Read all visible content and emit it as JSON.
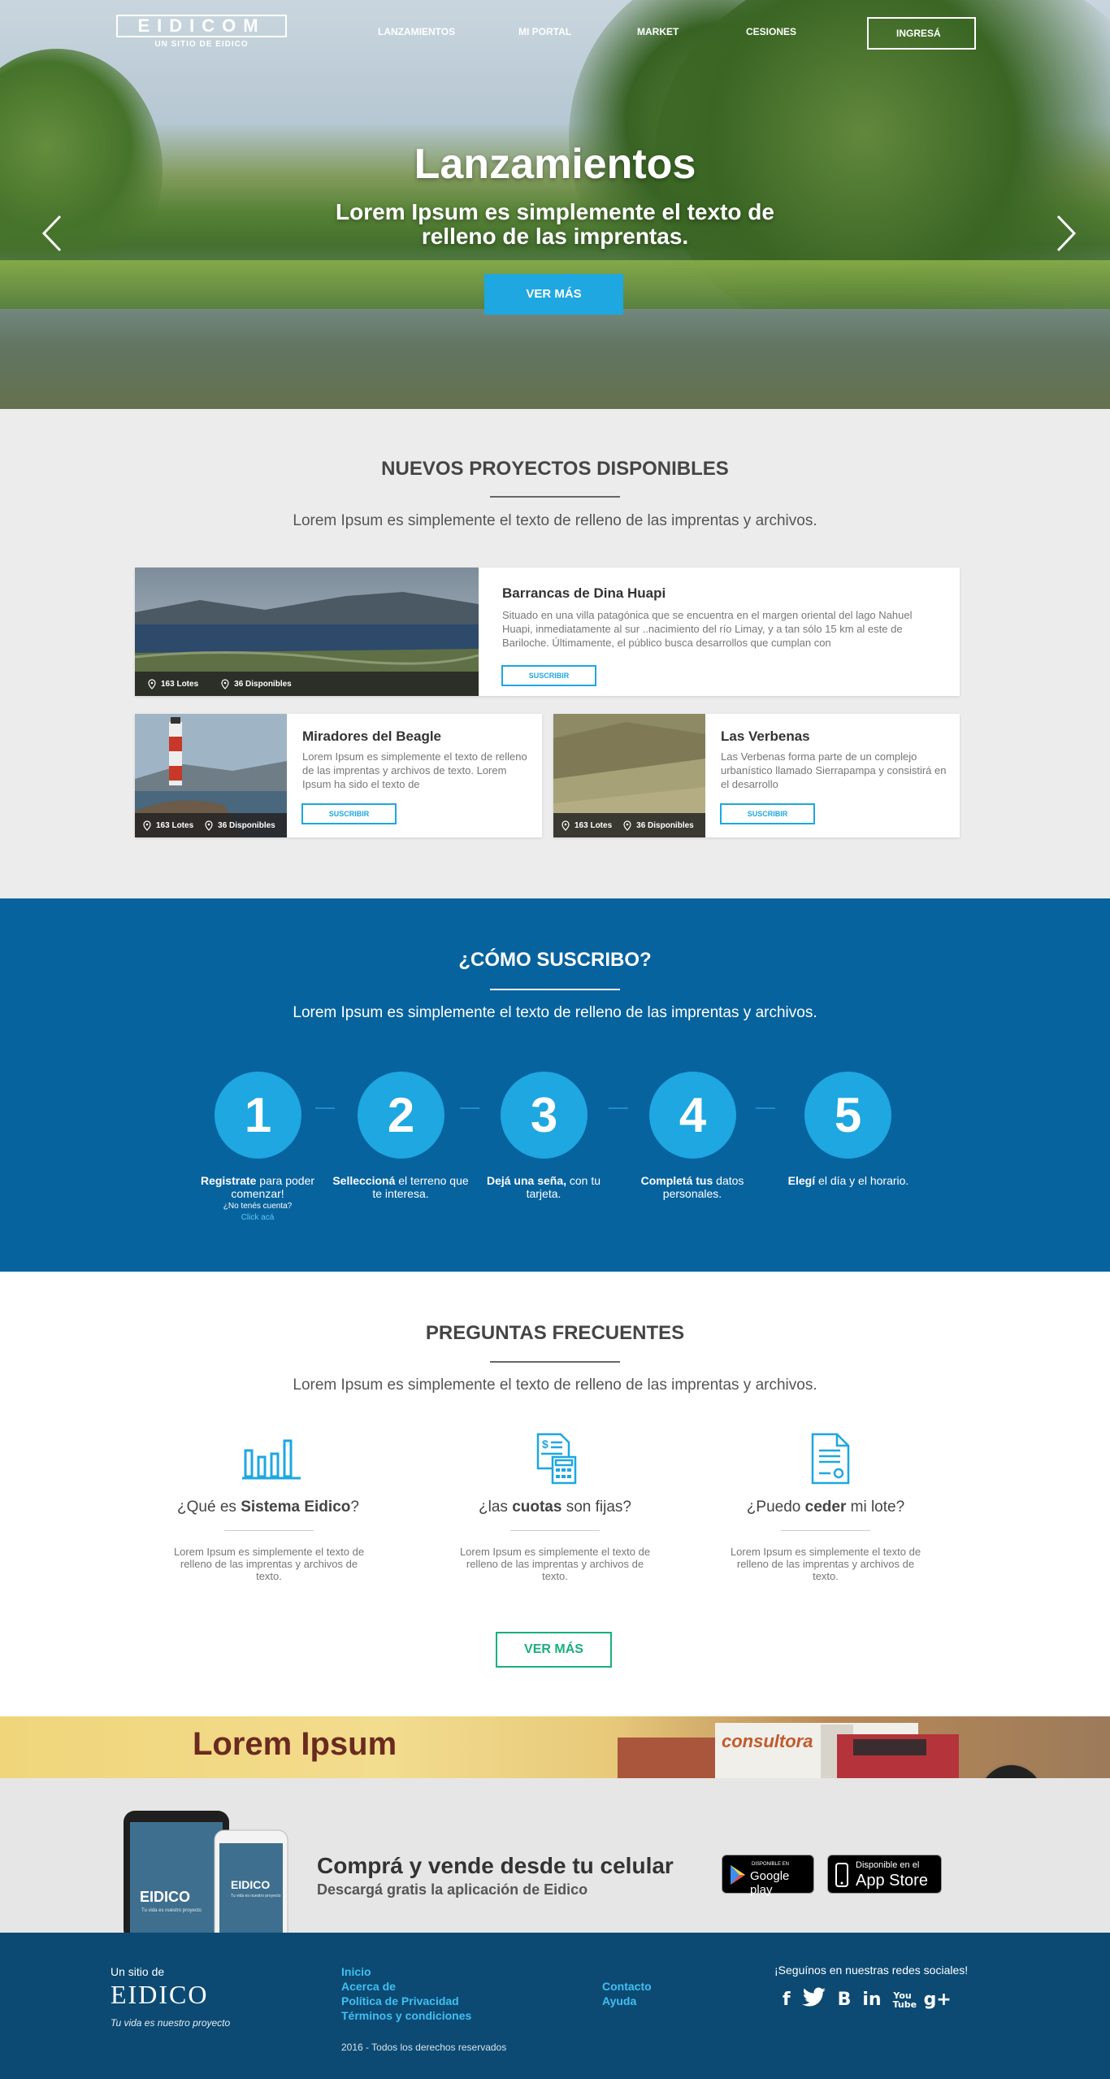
{
  "header": {
    "logo_text": "EIDICOM",
    "logo_sub": "UN SITIO DE EIDICO",
    "nav": [
      "LANZAMIENTOS",
      "MI PORTAL",
      "MARKET",
      "CESIONES"
    ],
    "login_label": "INGRESÁ"
  },
  "hero": {
    "title": "Lanzamientos",
    "subtitle": "Lorem Ipsum es simplemente el texto de relleno de las imprentas.",
    "button": "VER MÁS"
  },
  "proyectos": {
    "title": "NUEVOS PROYECTOS DISPONIBLES",
    "description": "Lorem Ipsum es simplemente el texto de relleno de las imprentas y archivos.",
    "cards": [
      {
        "name": "Barrancas de Dina Huapi",
        "text": "Situado en una villa patagónica que se encuentra en el margen oriental del lago Nahuel Huapi, inmediatamente al sur ..nacimiento del río Limay, y a tan sólo 15 km al este de Bariloche. Últimamente, el público busca desarrollos que cumplan con",
        "lotes": "163 Lotes",
        "disponibles": "36 Disponibles",
        "button": "SUSCRIBIR"
      },
      {
        "name": "Miradores del Beagle",
        "text": "Lorem Ipsum es simplemente el texto de relleno de las imprentas y archivos de texto. Lorem Ipsum ha sido el texto de",
        "lotes": "163 Lotes",
        "disponibles": "36 Disponibles",
        "button": "SUSCRIBIR"
      },
      {
        "name": "Las Verbenas",
        "text": "Las Verbenas forma parte de un complejo urbanístico llamado Sierrapampa y consistirá en el desarrollo",
        "lotes": "163 Lotes",
        "disponibles": "36 Disponibles",
        "button": "SUSCRIBIR"
      }
    ]
  },
  "suscribo": {
    "title": "¿CÓMO SUSCRIBO?",
    "description": "Lorem Ipsum es simplemente el texto de relleno de las imprentas y archivos.",
    "steps": [
      {
        "number": "1",
        "bold": "Registrate",
        "rest": " para poder comenzar!",
        "small": "¿No tenés cuenta?",
        "link": "Click acá"
      },
      {
        "number": "2",
        "bold": "Selleccioná",
        "rest": " el terreno que te interesa."
      },
      {
        "number": "3",
        "bold": "Dejá una seña,",
        "rest": " con tu tarjeta."
      },
      {
        "number": "4",
        "bold": "Completá tus",
        "rest": " datos personales."
      },
      {
        "number": "5",
        "bold": "Elegí",
        "rest": " el día y el horario."
      }
    ]
  },
  "preguntas": {
    "title": "PREGUNTAS FRECUENTES",
    "description": "Lorem Ipsum es simplemente el texto de relleno de las imprentas y archivos.",
    "items": [
      {
        "pre": "¿Qué es ",
        "bold": "Sistema Eidico",
        "post": "?",
        "answer": "Lorem Ipsum es simplemente el texto de relleno de las imprentas y archivos de texto.",
        "icon": "chart-icon"
      },
      {
        "pre": "¿las ",
        "bold": "cuotas",
        "post": " son fijas?",
        "answer": "Lorem Ipsum es simplemente el texto de relleno de las imprentas y archivos de texto.",
        "icon": "calculator-document-icon"
      },
      {
        "pre": "¿Puedo ",
        "bold": "ceder",
        "post": " mi lote?",
        "answer": "Lorem Ipsum es simplemente el texto de relleno de las imprentas y archivos de texto.",
        "icon": "contract-document-icon"
      }
    ],
    "button": "VER MÁS"
  },
  "banner": {
    "title": "Lorem Ipsum",
    "truck_text": "consultora"
  },
  "app": {
    "title": "Comprá y vende desde tu celular",
    "subtitle": "Descargá gratis la aplicación de Eidico",
    "phone_logo": "EIDICO",
    "phone_tagline": "Tu vida es nuestro proyecto",
    "google_small": "DISPONIBLE EN",
    "google_big": "Google play",
    "apple_small": "Disponible en el",
    "apple_big": "App Store"
  },
  "footer": {
    "site_of": "Un sitio de",
    "logo": "EIDICO",
    "tagline": "Tu vida es nuestro proyecto",
    "links_left": [
      "Inicio",
      "Acerca de",
      "Política de Privacidad",
      "Términos y condiciones"
    ],
    "links_right": [
      "Contacto",
      "Ayuda"
    ],
    "copyright": "2016 - Todos los derechos reservados",
    "social_title": "¡Seguínos en nuestras redes sociales!",
    "social_icons": [
      "f",
      "t",
      "B",
      "in",
      "You Tube",
      "g+"
    ]
  },
  "colors": {
    "accent": "#1ea7e0",
    "navy": "#07639e",
    "footer": "#0c4a73",
    "green": "#18b07a"
  }
}
